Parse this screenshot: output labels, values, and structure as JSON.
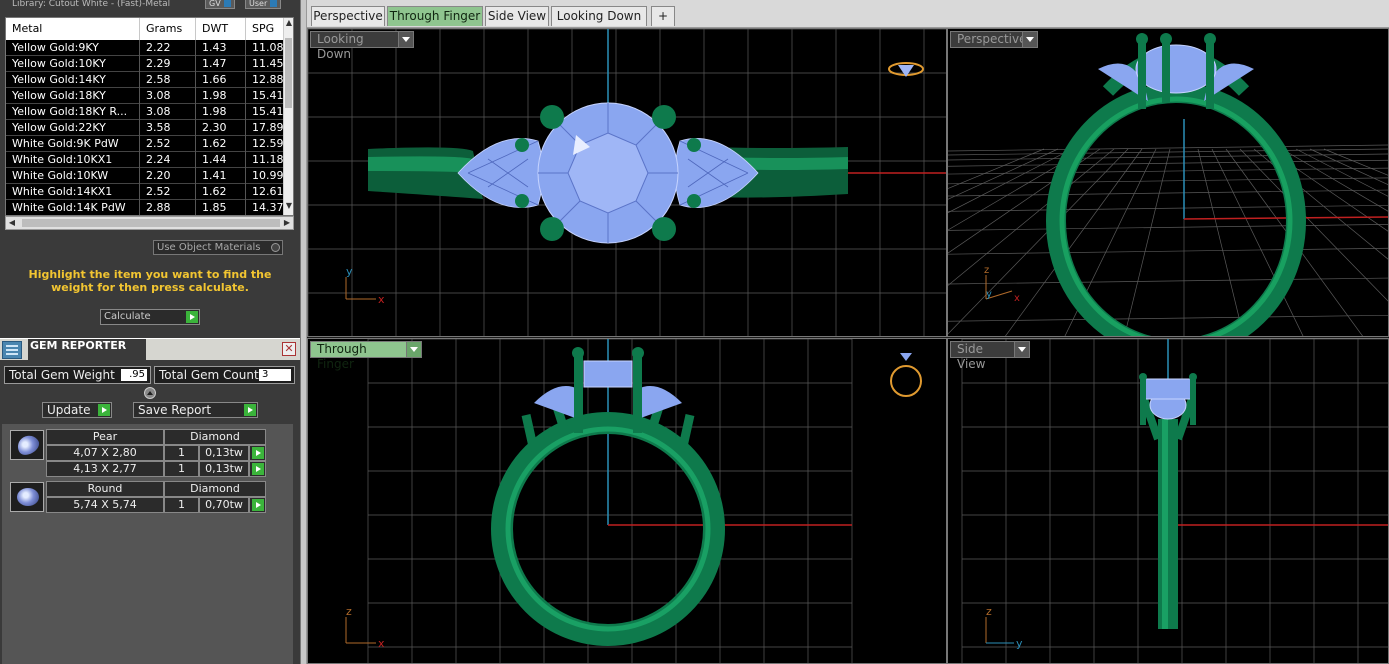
{
  "library": {
    "line": "Library: Cutout White - (Fast)-Metal",
    "gv_label": "GV",
    "user_label": "User"
  },
  "metal_table": {
    "headers": [
      "Metal",
      "Grams",
      "DWT",
      "SPG"
    ],
    "rows": [
      [
        "Yellow Gold:9KY",
        "2.22",
        "1.43",
        "11.08"
      ],
      [
        "Yellow Gold:10KY",
        "2.29",
        "1.47",
        "11.45"
      ],
      [
        "Yellow Gold:14KY",
        "2.58",
        "1.66",
        "12.88"
      ],
      [
        "Yellow Gold:18KY",
        "3.08",
        "1.98",
        "15.41"
      ],
      [
        "Yellow Gold:18KY R...",
        "3.08",
        "1.98",
        "15.41"
      ],
      [
        "Yellow Gold:22KY",
        "3.58",
        "2.30",
        "17.89"
      ],
      [
        "White Gold:9K PdW",
        "2.52",
        "1.62",
        "12.59"
      ],
      [
        "White Gold:10KX1",
        "2.24",
        "1.44",
        "11.18"
      ],
      [
        "White Gold:10KW",
        "2.20",
        "1.41",
        "10.99"
      ],
      [
        "White Gold:14KX1",
        "2.52",
        "1.62",
        "12.61"
      ],
      [
        "White Gold:14K PdW",
        "2.88",
        "1.85",
        "14.37"
      ]
    ]
  },
  "use_object_materials": "Use Object Materials",
  "hint": "Highlight the item you want to find the weight for then press calculate.",
  "calculate_label": "Calculate",
  "gem_reporter": {
    "title": "GEM REPORTER",
    "close": "✕",
    "total_weight_label": "Total Gem Weight",
    "total_weight_value": ".95",
    "total_count_label": "Total Gem Count",
    "total_count_value": "3",
    "update_label": "Update",
    "save_report_label": "Save Report",
    "groups": [
      {
        "shape": "Pear",
        "material": "Diamond",
        "rows": [
          {
            "size": "4,07 X 2,80",
            "qty": "1",
            "weight": "0,13tw"
          },
          {
            "size": "4,13 X 2,77",
            "qty": "1",
            "weight": "0,13tw"
          }
        ]
      },
      {
        "shape": "Round",
        "material": "Diamond",
        "rows": [
          {
            "size": "5,74 X 5,74",
            "qty": "1",
            "weight": "0,70tw"
          }
        ]
      }
    ]
  },
  "tabs": [
    "Perspective",
    "Through Finger",
    "Side View",
    "Looking Down"
  ],
  "active_tab": "Through Finger",
  "add_tab": "+",
  "viewports": {
    "top_left": "Looking Down",
    "top_right": "Perspective",
    "bottom_left": "Through Finger",
    "bottom_right": "Side View"
  },
  "axis": {
    "x": "x",
    "y": "y",
    "z": "z"
  },
  "colors": {
    "metal": "#0e7a4c",
    "gem": "#8aa6f0",
    "grid": "#5a5a5a",
    "x_axis": "#c02020",
    "y_axis": "#2b8fb8",
    "active_tab": "#8fc58f"
  }
}
